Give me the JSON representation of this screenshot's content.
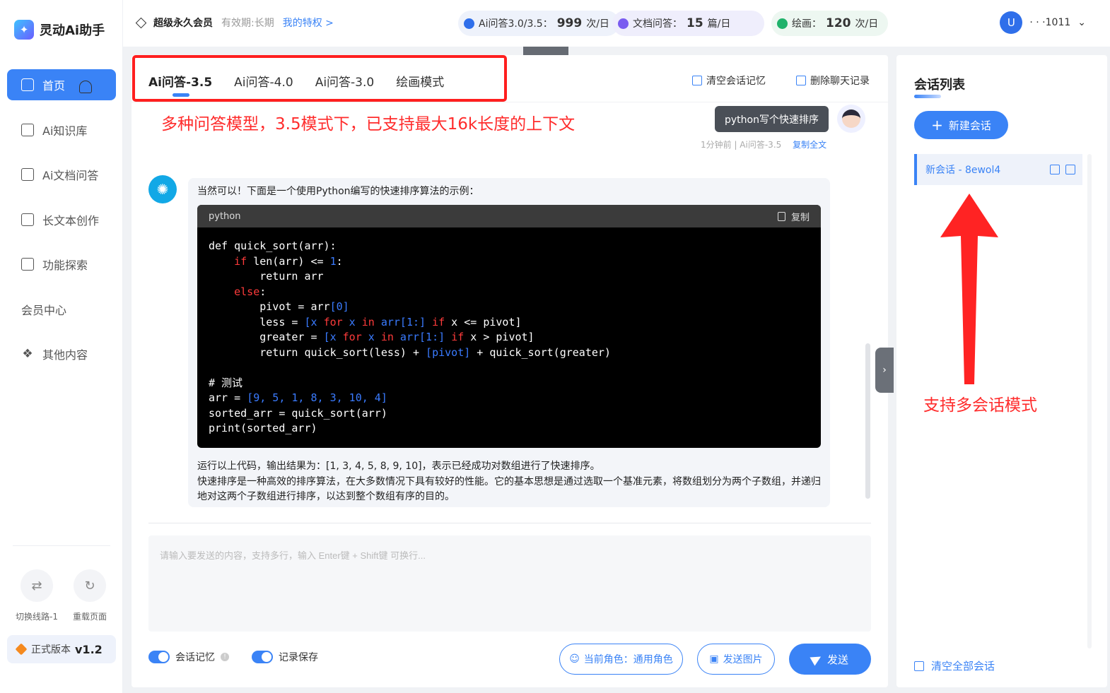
{
  "brand": {
    "name": "灵动Ai助手"
  },
  "nav": [
    {
      "label": "首页",
      "icon": "home-icon",
      "active": true
    },
    {
      "label": "Ai知识库",
      "icon": "book-icon"
    },
    {
      "label": "Ai文档问答",
      "icon": "ai-doc-icon"
    },
    {
      "label": "长文本创作",
      "icon": "document-icon"
    },
    {
      "label": "功能探索",
      "icon": "explore-icon"
    },
    {
      "label": "会员中心",
      "icon": "user-icon"
    },
    {
      "label": "其他内容",
      "icon": "grid-icon"
    }
  ],
  "utilities": {
    "switch_line": "切换线路-1",
    "reload": "重载页面"
  },
  "version": {
    "label": "正式版本",
    "value": "v1.2"
  },
  "topbar": {
    "vip_title": "超级永久会员",
    "vip_expiry": "有效期:长期",
    "vip_link": "我的特权 >",
    "quotas": [
      {
        "label": "Ai问答3.0/3.5：",
        "value": "999",
        "unit": "次/日",
        "color": "#2f6fea",
        "bg": "#eef2fb"
      },
      {
        "label": "文档问答：",
        "value": "15",
        "unit": "篇/日",
        "color": "#7a5cf0",
        "bg": "#efeefc"
      },
      {
        "label": "绘画：",
        "value": "120",
        "unit": "次/日",
        "color": "#20b26b",
        "bg": "#edf7f1"
      }
    ],
    "user_initial": "U",
    "user_name": "·  ·  ·1011"
  },
  "tabs": [
    "Ai问答-3.5",
    "Ai问答-4.0",
    "Ai问答-3.0",
    "绘画模式"
  ],
  "tools": {
    "clear_memory": "清空会话记忆",
    "delete_history": "删除聊天记录"
  },
  "annotations": {
    "models": "多种问答模型，3.5模式下，已支持最大16k长度的上下文",
    "multi_session": "支持多会话模式"
  },
  "chat": {
    "user_message": "python写个快速排序",
    "meta_time": "1分钟前 | Ai问答-3.5",
    "meta_copy": "复制全文",
    "bot_intro": "当然可以！下面是一个使用Python编写的快速排序算法的示例：",
    "code_lang": "python",
    "code_copy": "复制",
    "code_lines": [
      "def quick_sort(arr):",
      "    if len(arr) <= 1:",
      "        return arr",
      "    else:",
      "        pivot = arr[0]",
      "        less = [x for x in arr[1:] if x <= pivot]",
      "        greater = [x for x in arr[1:] if x > pivot]",
      "        return quick_sort(less) + [pivot] + quick_sort(greater)",
      "",
      "# 测试",
      "arr = [9, 5, 1, 8, 3, 10, 4]",
      "sorted_arr = quick_sort(arr)",
      "print(sorted_arr)"
    ],
    "bot_outro_1": "运行以上代码，输出结果为：[1, 3, 4, 5, 8, 9, 10]，表示已经成功对数组进行了快速排序。",
    "bot_outro_2": "快速排序是一种高效的排序算法，在大多数情况下具有较好的性能。它的基本思想是通过选取一个基准元素，将数组划分为两个子数组，并递归地对这两个子数组进行排序，以达到整个数组有序的目的。"
  },
  "input": {
    "placeholder": "请输入要发送的内容，支持多行，输入 Enter键 + Shift键 可换行..."
  },
  "controls": {
    "memory_label": "会话记忆",
    "save_label": "记录保存",
    "role_button": "当前角色：通用角色",
    "image_button": "发送图片",
    "send_button": "发送"
  },
  "rpanel": {
    "title": "会话列表",
    "new_chat": "新建会话",
    "conversations": [
      "新会话 - 8ewol4"
    ],
    "clear_all": "清空全部会话"
  },
  "colors": {
    "accent": "#3a83f6",
    "annotation": "#ff2b2b"
  }
}
